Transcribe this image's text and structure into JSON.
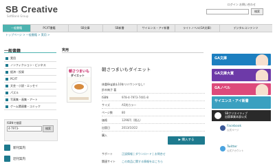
{
  "header": {
    "logo": "SB Creative",
    "logo_sub": "SoftBank Group",
    "toplinks": "ログイン  お問い合わせ",
    "search_button": "検索"
  },
  "nav": [
    {
      "label": "一般書籍",
      "active": true
    },
    {
      "label": "PC/IT書籍"
    },
    {
      "label": "SB文庫"
    },
    {
      "label": "SB新書"
    },
    {
      "label": "サイエンス・アイ新書"
    },
    {
      "label": "ライトノベル(GA文庫)"
    },
    {
      "label": "デジタルコンテンツ"
    }
  ],
  "breadcrumb": "トップページ > 一般書籍 > 実用 >",
  "sidebar": {
    "title": "一般書籍",
    "items": [
      "実用",
      "ノンフィクション・ビジネス",
      "経済・投資",
      "PC/IT",
      "文芸・小説・エッセイ",
      "パズル",
      "写真集・画集・アート",
      "ゲーム関連書・コミック"
    ],
    "isbn_label": "ISBNで検索",
    "isbn_value": "4-7973-",
    "isbn_button": "検索",
    "features": [
      "新刊案内",
      "近刊案内"
    ]
  },
  "main": {
    "category": "実用",
    "cover_title": "朝さつまいも",
    "cover_title2": "ダイエット",
    "book_title": "朝さつまいもダイエット",
    "description": "体重8kg減＆10年リバウンドなし！",
    "rows": [
      {
        "k": "鈴木絢子 著",
        "v": ""
      },
      {
        "k": "ISBN",
        "v": "978-4-7973-7401-8"
      },
      {
        "k": "サイズ",
        "v": "A5判カラー"
      },
      {
        "k": "ページ数",
        "v": "80"
      },
      {
        "k": "価格",
        "v": "1296円（税込）"
      },
      {
        "k": "出版日",
        "v": "2013/10/22"
      },
      {
        "k": "購入",
        "v": ""
      }
    ],
    "buy_button": "購入する",
    "links": [
      {
        "k": "サポート",
        "v": "正誤情報 | ダウンロード | お問合せ"
      },
      {
        "k": "関連サイト",
        "v": "この商品に関する情報をはこちら"
      }
    ]
  },
  "right": {
    "ads": [
      "GA文庫",
      "GA文庫大賞",
      "GAノベル",
      "サイエンス・アイ新書"
    ],
    "sb_line1": "SBクリエイティブ",
    "sb_line2": "出版事業本部公式",
    "facebook": "Facebook",
    "facebook_sub": "公式ページ",
    "twitter": "Twitter",
    "twitter_sub": "公式アカウント"
  }
}
